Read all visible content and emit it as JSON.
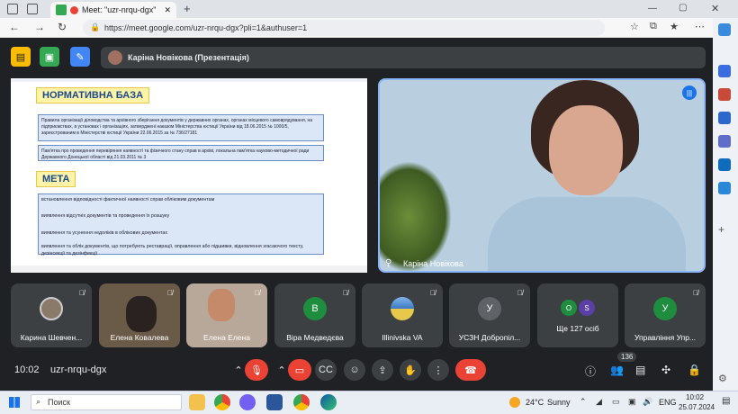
{
  "browser": {
    "tab_title": "Meet: \"uzr-nrqu-dgx\"",
    "url": "https://meet.google.com/uzr-nrqu-dgx?pli=1&authuser=1",
    "new_tab_icon": "+"
  },
  "meet": {
    "presenter_label": "Каріна Новікова (Презентація)",
    "speaker_name": "Каріна Новікова",
    "time": "10:02",
    "meeting_code": "uzr-nrqu-dgx",
    "people_count": "136"
  },
  "slide": {
    "heading1": "НОРМАТИВНА БАЗА",
    "box1": "Правила організації діловодства та архівного зберігання документів у державних органах, органах місцевого самоврядування, на підприємствах, в установах і організаціях, затверджені наказом Міністерства юстиції України від 18.06.2015 № 1000/5, зареєстрованим в Міністерстві юстиції України 22.06.2015 за № 736/27181",
    "box2": "Пам'ятка про проведення перевіряння наявності та фізичного стану справ в архіві, локальна пам'ятка науково-методичної ради Державного Донецької області від 21.03.2011 № 3",
    "heading2": "МЕТА",
    "goals": [
      "встановлення відповідності фактичної наявності справ обліковим документам",
      "виявлення відсутніх документів та проведення їх розшуку",
      "виявлення та усунення недоліків в облікових документах",
      "виявлення та облік документів, що потребують реставрації, оправлення або підшивки, відновлення згасаючого тексту, дезінсекції та дезінфекції"
    ]
  },
  "tiles": [
    {
      "name": "Карина Шевчен...",
      "type": "photo",
      "color": "#8a7a6a"
    },
    {
      "name": "Елена Ковалева",
      "type": "video",
      "color": "#5a4a3a"
    },
    {
      "name": "Елена Елена",
      "type": "video",
      "color": "#8a6a58"
    },
    {
      "name": "Віра Медведєва",
      "type": "letter",
      "letter": "В",
      "color": "#1e8e3e"
    },
    {
      "name": "Illinivska VA",
      "type": "logo",
      "color": "#3c78c3"
    },
    {
      "name": "УСЗН Добропіл...",
      "type": "letter",
      "letter": "У",
      "color": "#5f6368"
    },
    {
      "name": "Ще 127 осіб",
      "type": "multi",
      "letters": [
        "O",
        "S"
      ],
      "colors": [
        "#1e8e3e",
        "#5b3fa6"
      ]
    },
    {
      "name": "Управління Упр...",
      "type": "letter",
      "letter": "У",
      "color": "#1e8e3e"
    }
  ],
  "taskbar": {
    "search_label": "Поиск",
    "weather_temp": "24°C",
    "weather_text": "Sunny",
    "lang": "ENG",
    "clock_time": "10:02",
    "clock_date": "25.07.2024"
  },
  "colors": {
    "end_call": "#ea4335",
    "mic_off": "#ea4335",
    "accent": "#8ab4f8"
  }
}
